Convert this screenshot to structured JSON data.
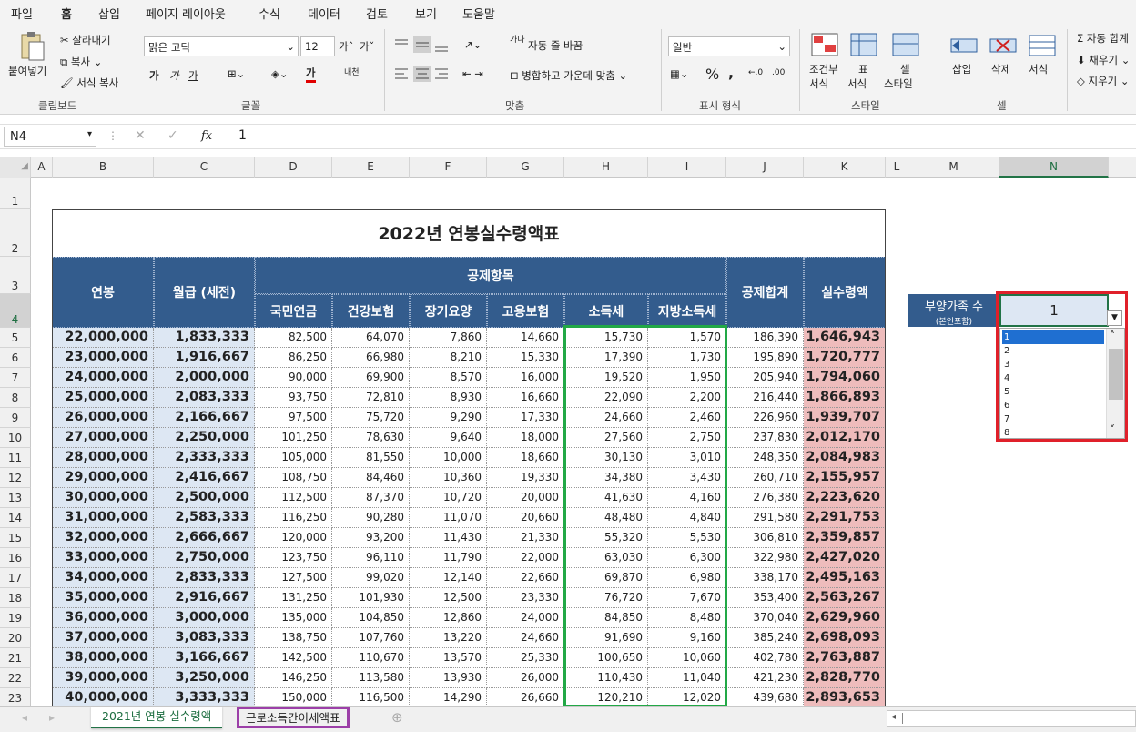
{
  "menu": [
    "파일",
    "홈",
    "삽입",
    "페이지 레이아웃",
    "수식",
    "데이터",
    "검토",
    "보기",
    "도움말"
  ],
  "ribbon": {
    "clipboard": {
      "paste": "붙여넣기",
      "cut": "잘라내기",
      "copy": "복사",
      "format_painter": "서식 복사",
      "label": "클립보드"
    },
    "font": {
      "name": "맑은 고딕",
      "size": "12",
      "bold": "가",
      "italic": "가",
      "underline": "가",
      "label": "글꼴",
      "font_color_glyph": "가",
      "phonetic": "내천"
    },
    "align": {
      "wrap": "자동 줄 바꿈",
      "merge": "병합하고 가운데 맞춤",
      "label": "맞춤",
      "wrap_glyph": "가나"
    },
    "number": {
      "format": "일반",
      "percent": "%",
      "comma": ",",
      "inc": "←.0",
      "dec": ".00",
      "label": "표시 형식"
    },
    "styles": {
      "cond": "조건부",
      "cond2": "서식",
      "table": "표",
      "table2": "서식",
      "cell": "셀",
      "cell2": "스타일",
      "label": "스타일"
    },
    "cells": {
      "insert": "삽입",
      "delete": "삭제",
      "format": "서식",
      "label": "셀"
    },
    "editing": {
      "autosum": "자동 합계",
      "fill": "채우기",
      "clear": "지우기"
    }
  },
  "formula_bar": {
    "name_box": "N4",
    "fx": "fx",
    "value": "1"
  },
  "columns": [
    "A",
    "B",
    "C",
    "D",
    "E",
    "F",
    "G",
    "H",
    "I",
    "J",
    "K",
    "L",
    "M",
    "N"
  ],
  "rows": [
    "1",
    "2",
    "3",
    "4",
    "5",
    "6",
    "7",
    "8",
    "9",
    "10",
    "11",
    "12",
    "13",
    "14",
    "15",
    "16",
    "17",
    "18",
    "19",
    "20",
    "21",
    "22",
    "23"
  ],
  "table": {
    "title": "2022년 연봉실수령액표",
    "hdr_salary": "연봉",
    "hdr_monthly": "월급 (세전)",
    "hdr_deduction": "공제항목",
    "hdr_total": "공제합계",
    "hdr_net": "실수령액",
    "sub_headers": [
      "국민연금",
      "건강보험",
      "장기요양",
      "고용보험",
      "소득세",
      "지방소득세"
    ],
    "rows": [
      [
        "22,000,000",
        "1,833,333",
        "82,500",
        "64,070",
        "7,860",
        "14,660",
        "15,730",
        "1,570",
        "186,390",
        "1,646,943"
      ],
      [
        "23,000,000",
        "1,916,667",
        "86,250",
        "66,980",
        "8,210",
        "15,330",
        "17,390",
        "1,730",
        "195,890",
        "1,720,777"
      ],
      [
        "24,000,000",
        "2,000,000",
        "90,000",
        "69,900",
        "8,570",
        "16,000",
        "19,520",
        "1,950",
        "205,940",
        "1,794,060"
      ],
      [
        "25,000,000",
        "2,083,333",
        "93,750",
        "72,810",
        "8,930",
        "16,660",
        "22,090",
        "2,200",
        "216,440",
        "1,866,893"
      ],
      [
        "26,000,000",
        "2,166,667",
        "97,500",
        "75,720",
        "9,290",
        "17,330",
        "24,660",
        "2,460",
        "226,960",
        "1,939,707"
      ],
      [
        "27,000,000",
        "2,250,000",
        "101,250",
        "78,630",
        "9,640",
        "18,000",
        "27,560",
        "2,750",
        "237,830",
        "2,012,170"
      ],
      [
        "28,000,000",
        "2,333,333",
        "105,000",
        "81,550",
        "10,000",
        "18,660",
        "30,130",
        "3,010",
        "248,350",
        "2,084,983"
      ],
      [
        "29,000,000",
        "2,416,667",
        "108,750",
        "84,460",
        "10,360",
        "19,330",
        "34,380",
        "3,430",
        "260,710",
        "2,155,957"
      ],
      [
        "30,000,000",
        "2,500,000",
        "112,500",
        "87,370",
        "10,720",
        "20,000",
        "41,630",
        "4,160",
        "276,380",
        "2,223,620"
      ],
      [
        "31,000,000",
        "2,583,333",
        "116,250",
        "90,280",
        "11,070",
        "20,660",
        "48,480",
        "4,840",
        "291,580",
        "2,291,753"
      ],
      [
        "32,000,000",
        "2,666,667",
        "120,000",
        "93,200",
        "11,430",
        "21,330",
        "55,320",
        "5,530",
        "306,810",
        "2,359,857"
      ],
      [
        "33,000,000",
        "2,750,000",
        "123,750",
        "96,110",
        "11,790",
        "22,000",
        "63,030",
        "6,300",
        "322,980",
        "2,427,020"
      ],
      [
        "34,000,000",
        "2,833,333",
        "127,500",
        "99,020",
        "12,140",
        "22,660",
        "69,870",
        "6,980",
        "338,170",
        "2,495,163"
      ],
      [
        "35,000,000",
        "2,916,667",
        "131,250",
        "101,930",
        "12,500",
        "23,330",
        "76,720",
        "7,670",
        "353,400",
        "2,563,267"
      ],
      [
        "36,000,000",
        "3,000,000",
        "135,000",
        "104,850",
        "12,860",
        "24,000",
        "84,850",
        "8,480",
        "370,040",
        "2,629,960"
      ],
      [
        "37,000,000",
        "3,083,333",
        "138,750",
        "107,760",
        "13,220",
        "24,660",
        "91,690",
        "9,160",
        "385,240",
        "2,698,093"
      ],
      [
        "38,000,000",
        "3,166,667",
        "142,500",
        "110,670",
        "13,570",
        "25,330",
        "100,650",
        "10,060",
        "402,780",
        "2,763,887"
      ],
      [
        "39,000,000",
        "3,250,000",
        "146,250",
        "113,580",
        "13,930",
        "26,000",
        "110,430",
        "11,040",
        "421,230",
        "2,828,770"
      ],
      [
        "40,000,000",
        "3,333,333",
        "150,000",
        "116,500",
        "14,290",
        "26,660",
        "120,210",
        "12,020",
        "439,680",
        "2,893,653"
      ]
    ]
  },
  "dependents": {
    "label": "부양가족 수",
    "sublabel": "(본인포함)",
    "value": "1",
    "options": [
      "1",
      "2",
      "3",
      "4",
      "5",
      "6",
      "7",
      "8"
    ]
  },
  "sheets": {
    "tab1": "2021년 연봉 실수령액",
    "tab2": "근로소득간이세액표"
  },
  "colors": {
    "header_bg": "#335c8d",
    "salary_bg": "#dde7f3",
    "net_bg": "#eebcbc",
    "green_box": "#22a846",
    "red_box": "#e0202a",
    "purple_tab": "#9c3fa8",
    "accent": "#217346"
  }
}
